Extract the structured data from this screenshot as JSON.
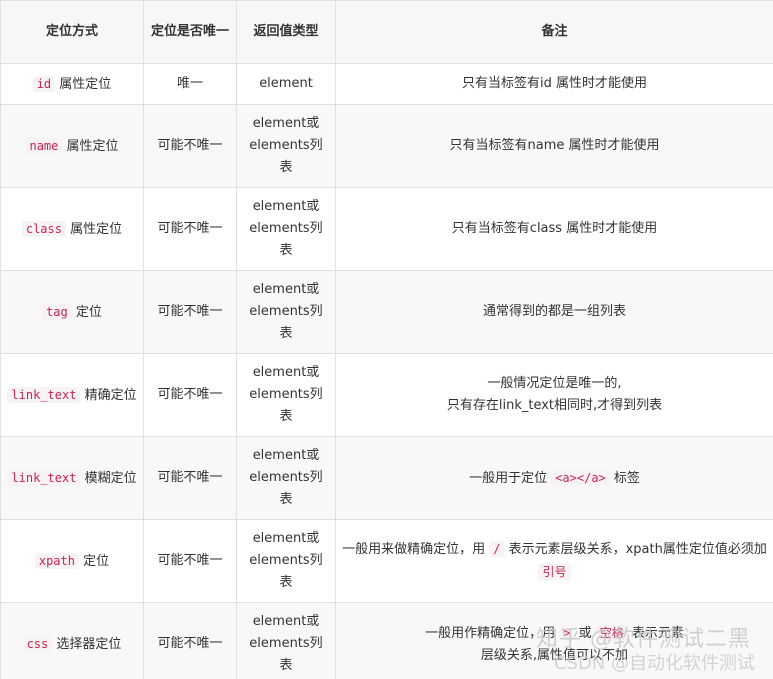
{
  "headers": [
    "定位方式",
    "定位是否唯一",
    "返回值类型",
    "备注"
  ],
  "rows": [
    {
      "code": "id",
      "method": " 属性定位",
      "unique": "唯一",
      "ret": "element",
      "note1": "只有当标签有id 属性时才能使用"
    },
    {
      "code": "name",
      "method": " 属性定位",
      "unique": "可能不唯一",
      "ret": "element或elements列表",
      "note1": "只有当标签有name 属性时才能使用"
    },
    {
      "code": "class",
      "method": " 属性定位",
      "unique": "可能不唯一",
      "ret": "element或elements列表",
      "note1": "只有当标签有class 属性时才能使用"
    },
    {
      "code": "tag",
      "method": " 定位",
      "unique": "可能不唯一",
      "ret": "element或elements列表",
      "note1": "通常得到的都是一组列表"
    },
    {
      "code": "link_text",
      "method": " 精确定位",
      "unique": "可能不唯一",
      "ret": "element或elements列表",
      "note1": "一般情况定位是唯一的,",
      "note2": "只有存在link_text相同时,才得到列表"
    },
    {
      "code": "link_text",
      "method": " 模糊定位",
      "unique": "可能不唯一",
      "ret": "element或elements列表",
      "note1": "一般用于定位 ",
      "note_code": "<a></a>",
      "note2": " 标签"
    },
    {
      "code": "xpath",
      "method": " 定位",
      "unique": "可能不唯一",
      "ret": "element或elements列表",
      "note1": "一般用来做精确定位，用 ",
      "note_code": "/",
      "note2": " 表示元素层级关系，xpath属性定位值必须加 ",
      "note_code2": "引号"
    },
    {
      "code": "css",
      "method": " 选择器定位",
      "unique": "可能不唯一",
      "ret": "element或elements列表",
      "note1": "一般用作精确定位，用 ",
      "note_code": ">",
      "note2": " 或 ",
      "note_code2": "空格",
      "note3": " 表示元素",
      "note4": "层级关系,属性值可以不加"
    }
  ],
  "watermark": {
    "line1": "知乎 @软件测试二黑",
    "line2": "CSDN @自动化软件测试"
  }
}
